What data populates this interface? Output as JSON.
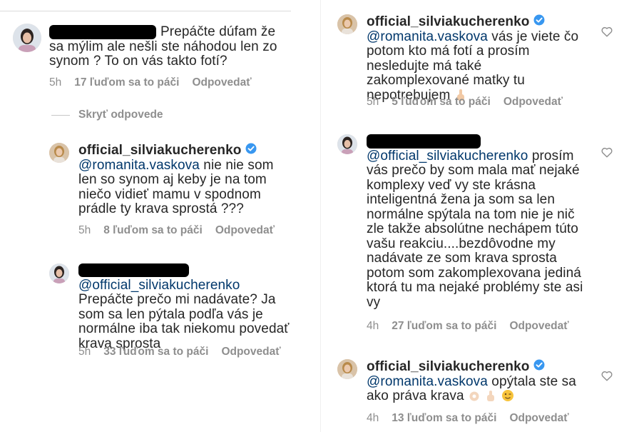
{
  "left": {
    "c1": {
      "text": "Prepáčte dúfam že sa mýlim ale nešli ste náhodou len zo synom ? To on vás takto fotí?",
      "time": "5h",
      "likes": "17 ľuďom sa to páči",
      "reply": "Odpovedať"
    },
    "hide_replies": "Skryť odpovede",
    "c2": {
      "username": "official_silviakucherenko",
      "mention": "@romanita.vaskova",
      "text": "nie nie som len so synom aj keby je na tom niečo vidieť mamu v spodnom prádle ty krava sprostá ???",
      "time": "5h",
      "likes": "8 ľuďom sa to páči",
      "reply": "Odpovedať"
    },
    "c3": {
      "mention": "@official_silviakucherenko",
      "text": "Prepáčte prečo mi nadávate? Ja som sa len pýtala podľa vás je normálne iba tak niekomu povedať krava sprosta",
      "time": "5h",
      "likes": "33 ľuďom sa to páči",
      "reply": "Odpovedať"
    }
  },
  "right": {
    "c4": {
      "username": "official_silviakucherenko",
      "mention": "@romanita.vaskova",
      "text": "vás je viete čo potom kto má fotí a prosím nesledujte má také zakomplexované matky tu nepotrebujem",
      "time": "5h",
      "likes": "5 ľuďom sa to páči",
      "reply": "Odpovedať"
    },
    "c5": {
      "mention": "@official_silviakucherenko",
      "text": "prosím vás prečo by som mala mať nejaké komplexy veď vy ste krásna inteligentná žena ja som sa len normálne spýtala na tom nie je nič zle takže absolútne nechápem túto vašu reakciu....bezdôvodne my nadávate ze som krava sprosta potom som zakomplexovana jediná ktorá tu ma nejaké problémy ste asi vy",
      "time": "4h",
      "likes": "27 ľuďom sa to páči",
      "reply": "Odpovedať"
    },
    "c6": {
      "username": "official_silviakucherenko",
      "mention": "@romanita.vaskova",
      "text": "opýtala ste sa ako práva krava",
      "time": "4h",
      "likes": "13 ľuďom sa to páči",
      "reply": "Odpovedať"
    }
  },
  "colors": {
    "mention": "#00376b",
    "meta": "#8e8e8e",
    "verified": "#3897f0",
    "redaction": "#000000"
  },
  "icons": [
    "heart-outline-icon",
    "verified-badge-icon",
    "avatar-photo",
    "hand-emoji-icon"
  ]
}
